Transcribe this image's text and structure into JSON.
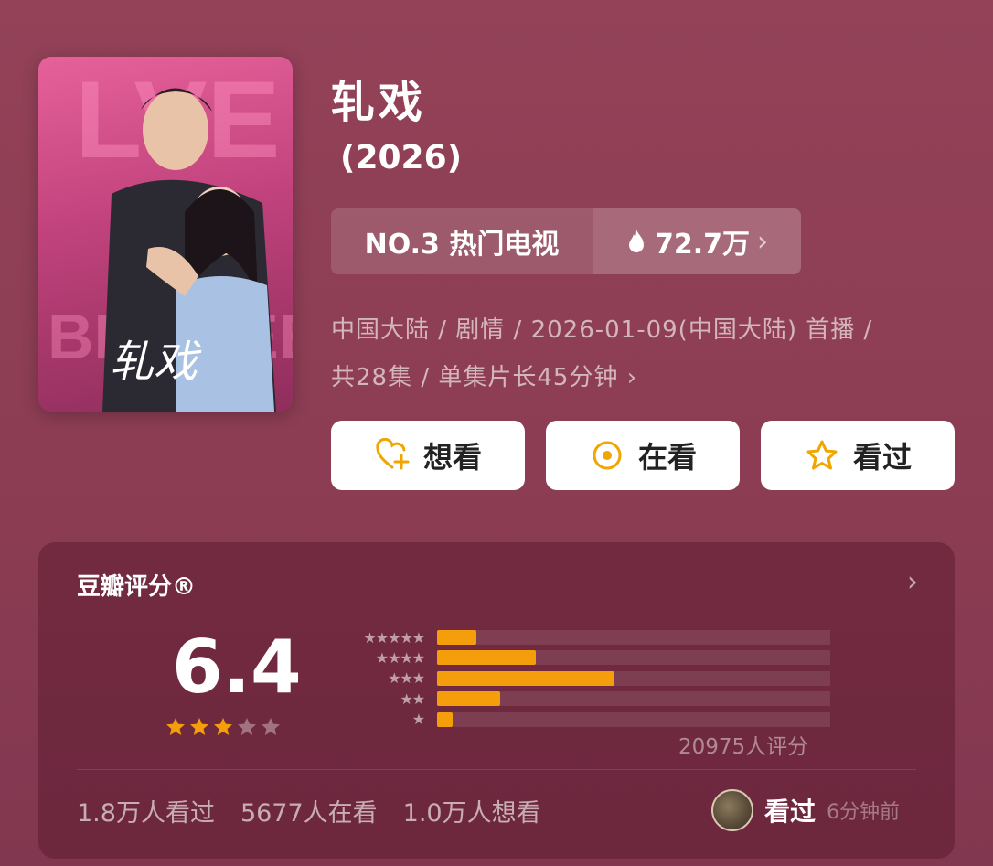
{
  "title": "轧戏",
  "year": "(2026)",
  "rank": {
    "label": "NO.3 热门电视",
    "heat": "72.7万"
  },
  "meta": {
    "line1": "中国大陆 / 剧情 / 2026-01-09(中国大陆) 首播 /",
    "line2": "共28集 / 单集片长45分钟 ›"
  },
  "actions": [
    {
      "label": "想看",
      "icon": "heart-plus-icon"
    },
    {
      "label": "在看",
      "icon": "circle-dot-icon"
    },
    {
      "label": "看过",
      "icon": "star-icon"
    }
  ],
  "rating": {
    "title": "豆瓣评分®",
    "score": "6.4",
    "stars_filled": 3,
    "stars_total": 5,
    "count_text": "20975人评分",
    "chart_data": {
      "type": "bar",
      "categories": [
        "5星",
        "4星",
        "3星",
        "2星",
        "1星"
      ],
      "values": [
        0.1,
        0.25,
        0.45,
        0.16,
        0.04
      ]
    }
  },
  "stats": {
    "watched": "1.8万人看过",
    "watching": "5677人在看",
    "want": "1.0万人想看"
  },
  "user": {
    "status": "看过",
    "time": "6分钟前"
  },
  "colors": {
    "accent": "#f59e0b",
    "background": "#8c3e54"
  }
}
